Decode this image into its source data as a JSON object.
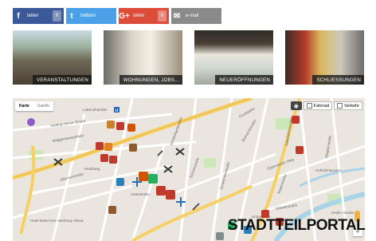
{
  "share": {
    "facebook": {
      "icon": "facebook-icon",
      "glyph": "f",
      "label": "teilen",
      "count": "0"
    },
    "twitter": {
      "icon": "twitter-icon",
      "glyph": "t",
      "label": "twittern"
    },
    "googleplus": {
      "icon": "googleplus-icon",
      "glyph": "G+",
      "label": "teilen",
      "count": "0"
    },
    "email": {
      "icon": "email-icon",
      "glyph": "✉",
      "label": "e-mail"
    }
  },
  "tiles": [
    {
      "caption": "VERANSTALTUNGEN"
    },
    {
      "caption": "WOHNUNGEN, JOBS..."
    },
    {
      "caption": "NEUERÖFFNUNGEN"
    },
    {
      "caption": "SCHLIESSUNGEN"
    }
  ],
  "map": {
    "types": {
      "map": "Karte",
      "satellite": "Satellit"
    },
    "layers": {
      "bike": "Fahrrad",
      "traffic": "Verkehr"
    },
    "streets": [
      "Lutterothstraße",
      "Harting-Hesse-Straße",
      "Müggenkampstraße",
      "Heußweg",
      "Ottersenstraße",
      "Osterstraße",
      "Eichenstraße",
      "Schwenckestraße",
      "Bismarckstraße",
      "Hohlufchaussee",
      "Hoheluftchaussee",
      "Wagnerstraße",
      "Fruchtallee",
      "Bogenstraße",
      "Hotel Motel One Hamburg-Altona",
      "Unnastraße",
      "Gärtnerstraße",
      "Eppendorfer Weg",
      "Heider Straße",
      "Schäferkampsallee"
    ],
    "colors": {
      "land": "#eae6df",
      "road": "#ffffff",
      "major": "#f6cf65",
      "water": "#a9d3e6",
      "park": "#cde8b8"
    }
  },
  "brand": {
    "text": "STADTTEILPORTAL"
  }
}
